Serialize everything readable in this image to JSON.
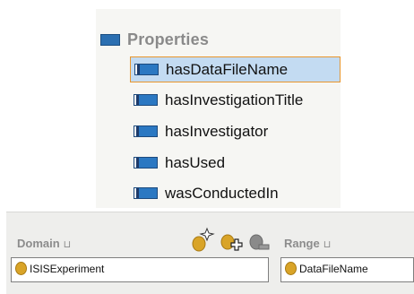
{
  "properties": {
    "header_label": "Properties",
    "items": [
      {
        "label": "hasDataFileName",
        "selected": true
      },
      {
        "label": "hasInvestigationTitle",
        "selected": false
      },
      {
        "label": "hasInvestigator",
        "selected": false
      },
      {
        "label": "hasUsed",
        "selected": false
      },
      {
        "label": "wasConductedIn",
        "selected": false
      }
    ]
  },
  "domain": {
    "label": "Domain",
    "suffix": "⊔",
    "value": "ISISExperiment"
  },
  "range": {
    "label": "Range",
    "suffix": "⊔",
    "value": "DataFileName"
  },
  "toolbar": {
    "icons": [
      "add-class-icon",
      "add-class-plus-icon",
      "remove-class-icon"
    ]
  },
  "colors": {
    "selection_bg": "#c3dbf2",
    "selection_border": "#e8962e",
    "class_dot": "#d9a428",
    "property_icon": "#2b78c2"
  }
}
